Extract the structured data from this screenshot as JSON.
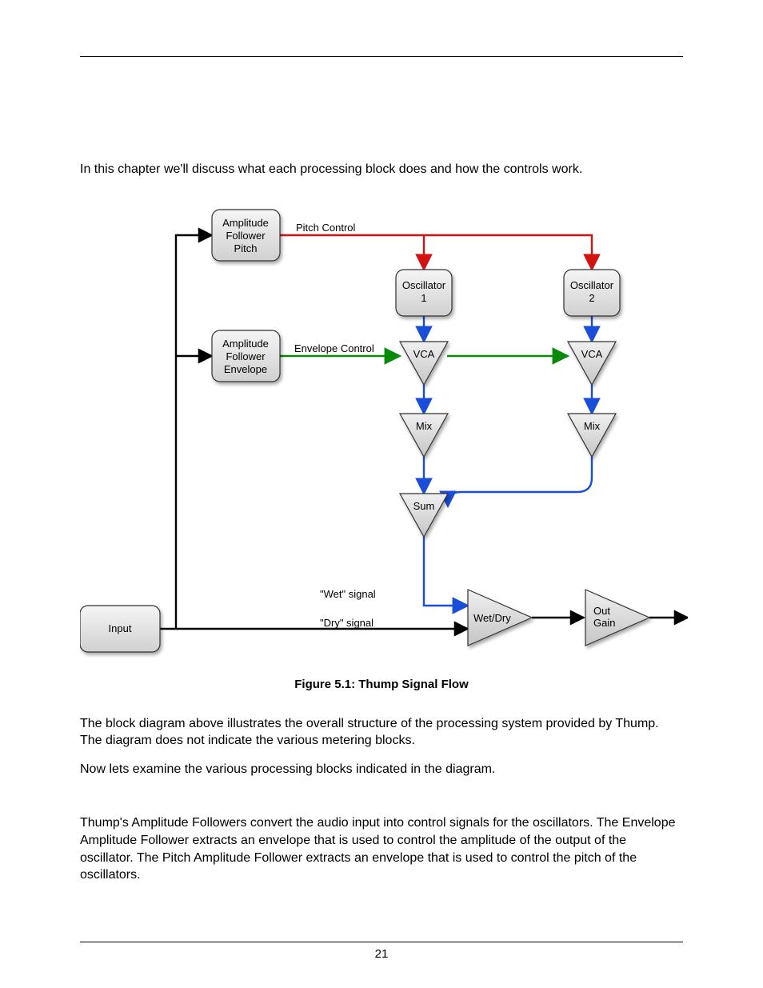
{
  "page_number": "21",
  "intro": "In this chapter we'll discuss what each processing block does and how the controls work.",
  "caption": "Figure 5.1: Thump Signal Flow",
  "para1": "The block diagram above illustrates the overall structure of the processing system provided by Thump. The diagram does not indicate the various metering blocks.",
  "para2": "Now lets examine the various processing blocks indicated in the diagram.",
  "para3": "Thump's Amplitude Followers convert the audio input into control signals for the oscillators. The Envelope Amplitude Follower extracts an envelope that is used to control the amplitude of the output of the oscillator. The Pitch Amplitude Follower extracts an envelope that is used to control the pitch of the oscillators.",
  "diagram": {
    "nodes": {
      "input": "Input",
      "amp_pitch_l1": "Amplitude",
      "amp_pitch_l2": "Follower",
      "amp_pitch_l3": "Pitch",
      "amp_env_l1": "Amplitude",
      "amp_env_l2": "Follower",
      "amp_env_l3": "Envelope",
      "pitch_control": "Pitch Control",
      "env_control": "Envelope Control",
      "osc1_l1": "Oscillator",
      "osc1_l2": "1",
      "osc2_l1": "Oscillator",
      "osc2_l2": "2",
      "vca": "VCA",
      "vca2": "VCA",
      "mix": "Mix",
      "mix2": "Mix",
      "sum": "Sum",
      "wet_label": "\"Wet\" signal",
      "dry_label": "\"Dry\" signal",
      "wetdry": "Wet/Dry",
      "outgain_l1": "Out",
      "outgain_l2": "Gain"
    }
  }
}
